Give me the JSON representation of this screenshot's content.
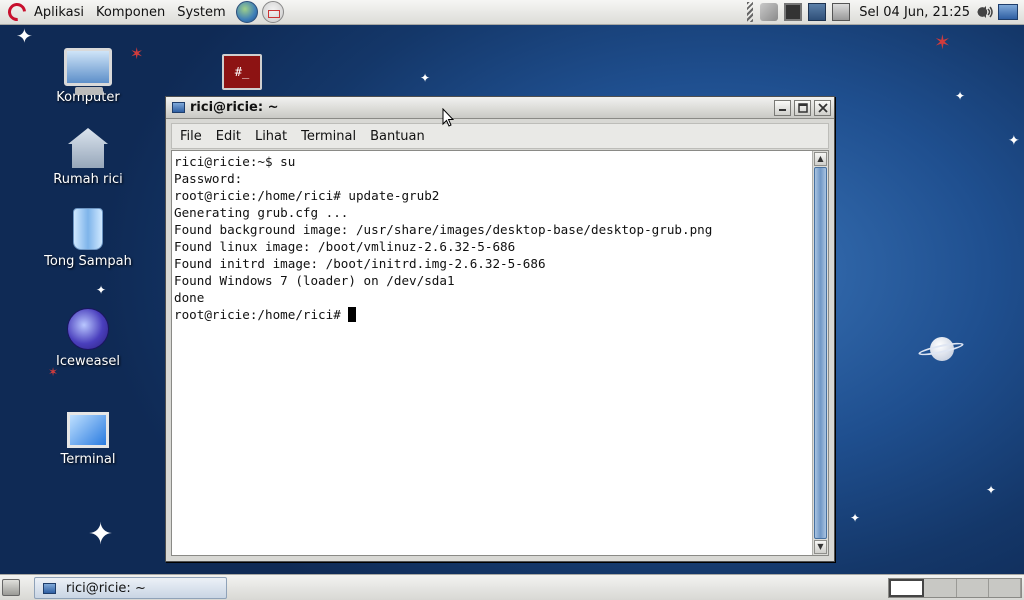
{
  "top_panel": {
    "menus": [
      "Aplikasi",
      "Komponen",
      "System"
    ],
    "clock": "Sel 04 Jun, 21:25"
  },
  "desktop": {
    "icons": [
      {
        "label": "Komputer",
        "icon": "computer-icon"
      },
      {
        "label": "Rumah rici",
        "icon": "home-folder-icon"
      },
      {
        "label": "Tong Sampah",
        "icon": "trash-icon"
      },
      {
        "label": "Iceweasel",
        "icon": "iceweasel-icon"
      },
      {
        "label": "Terminal",
        "icon": "terminal-icon"
      }
    ],
    "root_terminal_icon_text": "#_"
  },
  "terminal_window": {
    "title": "rici@ricie: ~",
    "menu": [
      "File",
      "Edit",
      "Lihat",
      "Terminal",
      "Bantuan"
    ],
    "lines": [
      "rici@ricie:~$ su",
      "Password:",
      "root@ricie:/home/rici# update-grub2",
      "Generating grub.cfg ...",
      "Found background image: /usr/share/images/desktop-base/desktop-grub.png",
      "Found linux image: /boot/vmlinuz-2.6.32-5-686",
      "Found initrd image: /boot/initrd.img-2.6.32-5-686",
      "Found Windows 7 (loader) on /dev/sda1",
      "done"
    ],
    "prompt": "root@ricie:/home/rici# "
  },
  "bottom_panel": {
    "task": "rici@ricie: ~",
    "workspace_count": 4,
    "active_workspace": 1
  },
  "colors": {
    "desktop_bg": "#1f4f8f",
    "terminal_bg": "#ffffff",
    "panel_bg": "#e6e6e2",
    "accent": "#2f5fa3"
  }
}
